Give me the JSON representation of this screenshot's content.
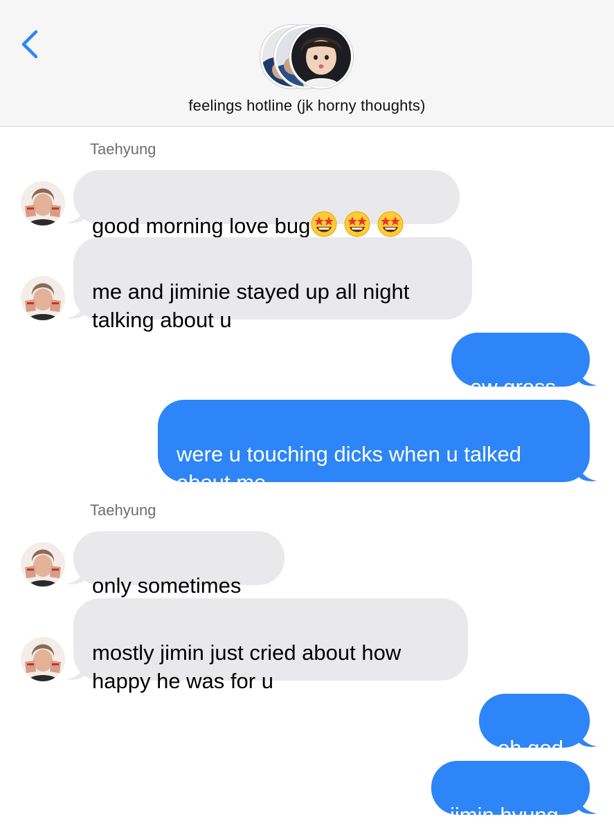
{
  "header": {
    "group_name": "feelings hotline (jk horny thoughts)"
  },
  "colors": {
    "accent": "#2d85f7",
    "incoming_bubble": "#e9e9eb",
    "header_bg": "#f6f6f7",
    "sender_label": "#6d6d72"
  },
  "messages": [
    {
      "sender": "Taehyung"
    },
    {
      "text": "good morning love bug",
      "emoji": "star-struck",
      "emoji_count": 3
    },
    {
      "text": "me and jiminie stayed up all night\ntalking about u"
    },
    {
      "text": "ew gross"
    },
    {
      "text": "were u touching dicks when u talked\nabout me"
    },
    {
      "sender": "Taehyung"
    },
    {
      "text": "only sometimes"
    },
    {
      "text": "mostly jimin just cried about how\nhappy he was for u"
    },
    {
      "text": "oh god"
    },
    {
      "text": "jimin hyung"
    }
  ]
}
